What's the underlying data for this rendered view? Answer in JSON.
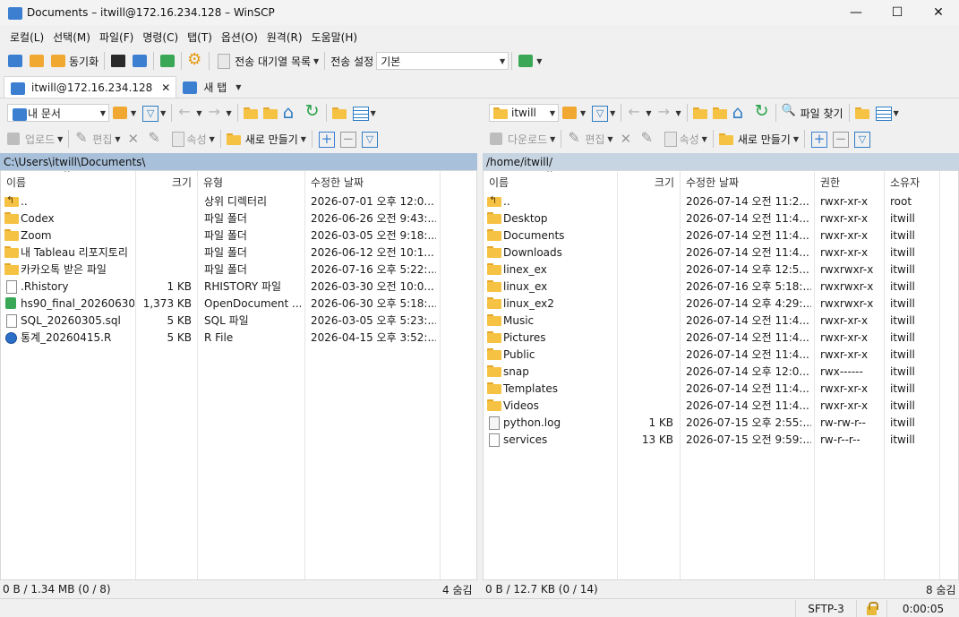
{
  "window": {
    "title": "Documents – itwill@172.16.234.128 – WinSCP",
    "minimize": "—",
    "maximize": "☐",
    "close": "✕"
  },
  "menu": [
    "로컬(L)",
    "선택(M)",
    "파일(F)",
    "명령(C)",
    "탭(T)",
    "옵션(O)",
    "원격(R)",
    "도움말(H)"
  ],
  "toolbar": {
    "sync_label": "동기화",
    "queue_label": "전송 대기열 목록",
    "transfer_settings_label": "전송 설정",
    "transfer_settings_value": "기본"
  },
  "tabs": {
    "session_label": "itwill@172.16.234.128",
    "session_close": "✕",
    "new_tab_label": "새 탭"
  },
  "left": {
    "location": "내 문서",
    "upload_label": "업로드",
    "edit_label": "편집",
    "properties_label": "속성",
    "new_label": "새로 만들기",
    "path": "C:\\Users\\itwill\\Documents\\",
    "columns": [
      "이름",
      "크기",
      "유형",
      "수정한 날짜"
    ],
    "rows": [
      {
        "name": "..",
        "size": "",
        "type": "상위 디렉터리",
        "modified": "2026-07-01 오후 12:0...",
        "icon": "parent"
      },
      {
        "name": "Codex",
        "size": "",
        "type": "파일 폴더",
        "modified": "2026-06-26 오전 9:43:...",
        "icon": "folder"
      },
      {
        "name": "Zoom",
        "size": "",
        "type": "파일 폴더",
        "modified": "2026-03-05 오전 9:18:...",
        "icon": "folder"
      },
      {
        "name": "내 Tableau 리포지토리",
        "size": "",
        "type": "파일 폴더",
        "modified": "2026-06-12 오전 10:1...",
        "icon": "folder"
      },
      {
        "name": "카카오톡 받은 파일",
        "size": "",
        "type": "파일 폴더",
        "modified": "2026-07-16 오후 5:22:...",
        "icon": "folder"
      },
      {
        "name": ".Rhistory",
        "size": "1 KB",
        "type": "RHISTORY 파일",
        "modified": "2026-03-30 오전 10:0...",
        "icon": "file"
      },
      {
        "name": "hs90_final_20260630....",
        "size": "1,373 KB",
        "type": "OpenDocument ...",
        "modified": "2026-06-30 오후 5:18:...",
        "icon": "ods"
      },
      {
        "name": "SQL_20260305.sql",
        "size": "5 KB",
        "type": "SQL 파일",
        "modified": "2026-03-05 오후 5:23:...",
        "icon": "file"
      },
      {
        "name": "통계_20260415.R",
        "size": "5 KB",
        "type": "R File",
        "modified": "2026-04-15 오후 3:52:...",
        "icon": "r"
      }
    ],
    "status": "0 B / 1.34 MB (0 / 8)",
    "hidden": "4 숨김"
  },
  "right": {
    "location": "itwill",
    "download_label": "다운로드",
    "edit_label": "편집",
    "properties_label": "속성",
    "new_label": "새로 만들기",
    "find_label": "파일 찾기",
    "path": "/home/itwill/",
    "columns": [
      "이름",
      "크기",
      "수정한 날짜",
      "권한",
      "소유자"
    ],
    "rows": [
      {
        "name": "..",
        "size": "",
        "modified": "2026-07-14 오전 11:2...",
        "rights": "rwxr-xr-x",
        "owner": "root",
        "icon": "parent"
      },
      {
        "name": "Desktop",
        "size": "",
        "modified": "2026-07-14 오전 11:4...",
        "rights": "rwxr-xr-x",
        "owner": "itwill",
        "icon": "folder"
      },
      {
        "name": "Documents",
        "size": "",
        "modified": "2026-07-14 오전 11:4...",
        "rights": "rwxr-xr-x",
        "owner": "itwill",
        "icon": "folder"
      },
      {
        "name": "Downloads",
        "size": "",
        "modified": "2026-07-14 오전 11:4...",
        "rights": "rwxr-xr-x",
        "owner": "itwill",
        "icon": "folder"
      },
      {
        "name": "linex_ex",
        "size": "",
        "modified": "2026-07-14 오후 12:5...",
        "rights": "rwxrwxr-x",
        "owner": "itwill",
        "icon": "folder"
      },
      {
        "name": "linux_ex",
        "size": "",
        "modified": "2026-07-16 오후 5:18:...",
        "rights": "rwxrwxr-x",
        "owner": "itwill",
        "icon": "folder"
      },
      {
        "name": "linux_ex2",
        "size": "",
        "modified": "2026-07-14 오후 4:29:...",
        "rights": "rwxrwxr-x",
        "owner": "itwill",
        "icon": "folder"
      },
      {
        "name": "Music",
        "size": "",
        "modified": "2026-07-14 오전 11:4...",
        "rights": "rwxr-xr-x",
        "owner": "itwill",
        "icon": "folder"
      },
      {
        "name": "Pictures",
        "size": "",
        "modified": "2026-07-14 오전 11:4...",
        "rights": "rwxr-xr-x",
        "owner": "itwill",
        "icon": "folder"
      },
      {
        "name": "Public",
        "size": "",
        "modified": "2026-07-14 오전 11:4...",
        "rights": "rwxr-xr-x",
        "owner": "itwill",
        "icon": "folder"
      },
      {
        "name": "snap",
        "size": "",
        "modified": "2026-07-14 오후 12:0...",
        "rights": "rwx------",
        "owner": "itwill",
        "icon": "folder"
      },
      {
        "name": "Templates",
        "size": "",
        "modified": "2026-07-14 오전 11:4...",
        "rights": "rwxr-xr-x",
        "owner": "itwill",
        "icon": "folder"
      },
      {
        "name": "Videos",
        "size": "",
        "modified": "2026-07-14 오전 11:4...",
        "rights": "rwxr-xr-x",
        "owner": "itwill",
        "icon": "folder"
      },
      {
        "name": "python.log",
        "size": "1 KB",
        "modified": "2026-07-15 오후 2:55:...",
        "rights": "rw-rw-r--",
        "owner": "itwill",
        "icon": "log"
      },
      {
        "name": "services",
        "size": "13 KB",
        "modified": "2026-07-15 오전 9:59:...",
        "rights": "rw-r--r--",
        "owner": "itwill",
        "icon": "file"
      }
    ],
    "status": "0 B / 12.7 KB (0 / 14)",
    "hidden": "8 숨김"
  },
  "statusbar": {
    "protocol": "SFTP-3",
    "elapsed": "0:00:05"
  },
  "colors": {
    "left_path_bg": "#a8c0d9",
    "right_path_bg": "#c7d4e2",
    "folder": "#f6c243"
  }
}
